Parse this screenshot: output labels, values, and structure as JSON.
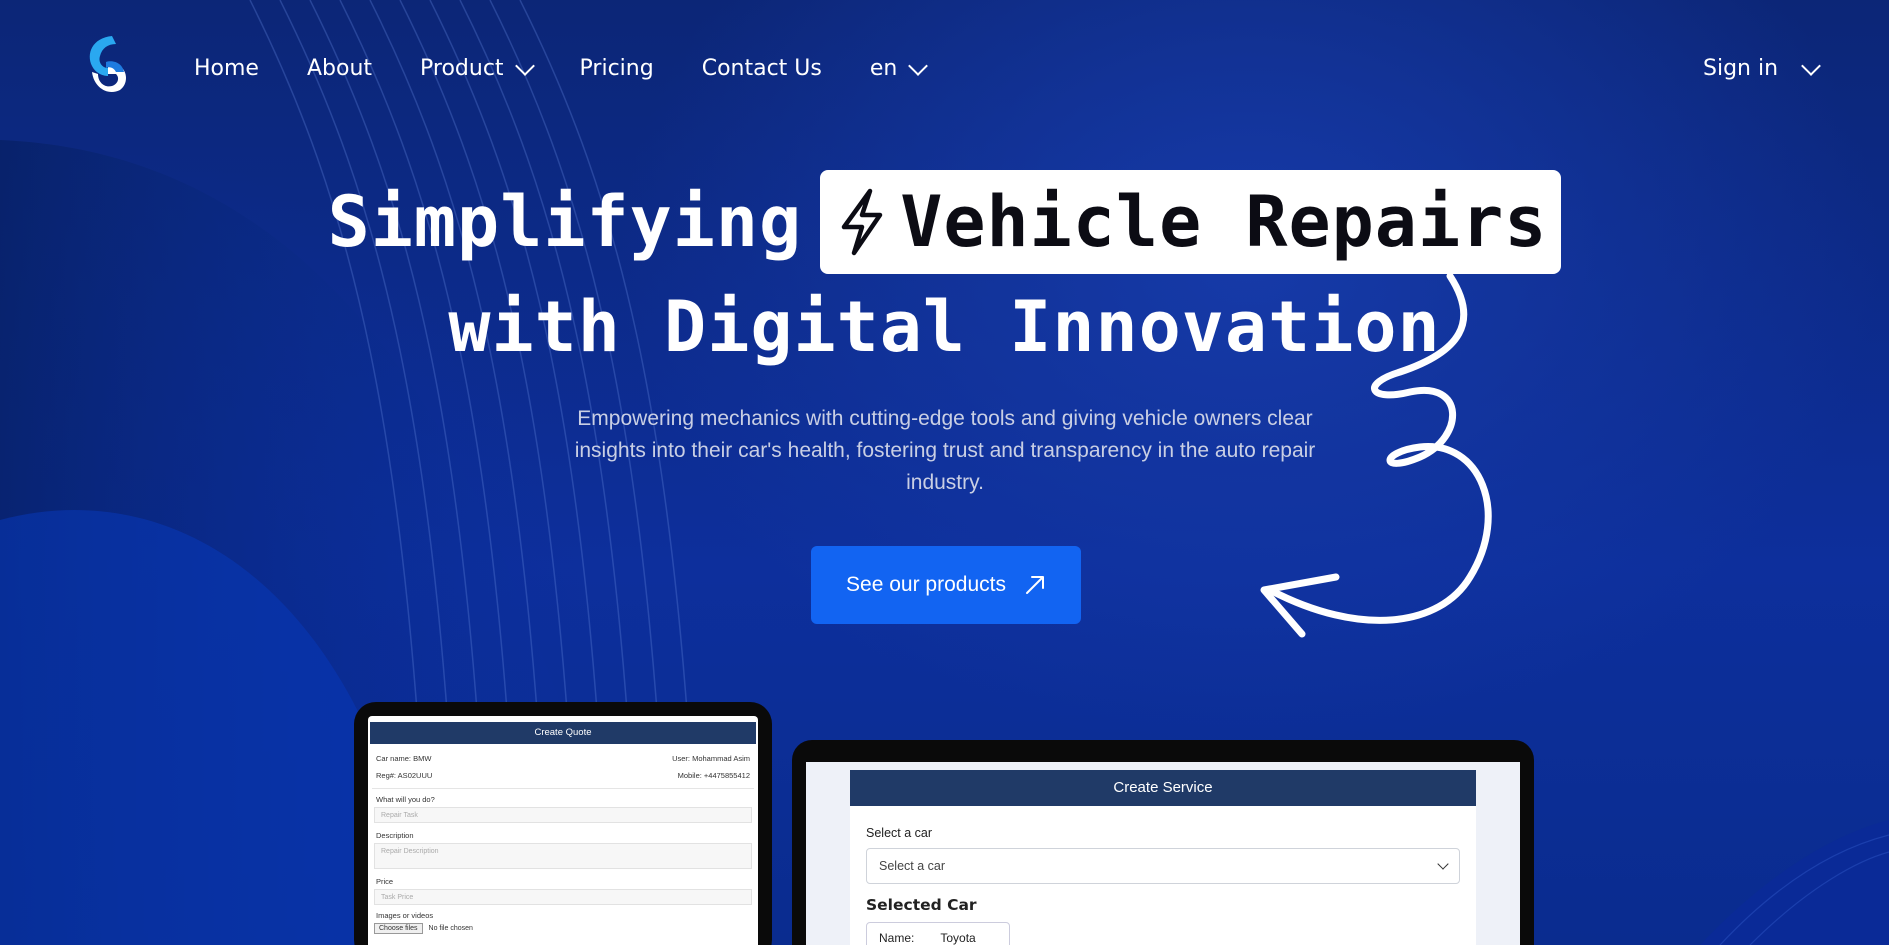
{
  "nav": {
    "items": [
      {
        "label": "Home",
        "dropdown": false
      },
      {
        "label": "About",
        "dropdown": false
      },
      {
        "label": "Product",
        "dropdown": true
      },
      {
        "label": "Pricing",
        "dropdown": false
      },
      {
        "label": "Contact Us",
        "dropdown": false
      },
      {
        "label": "en",
        "dropdown": true
      }
    ],
    "sign_in": "Sign in"
  },
  "hero": {
    "title_part1": "Simplifying",
    "title_highlight": "Vehicle Repairs",
    "title_line2": "with Digital Innovation",
    "subtitle": "Empowering mechanics with cutting-edge tools and giving vehicle owners clear insights into their car's health, fostering trust and transparency in the auto repair industry.",
    "cta_label": "See our products"
  },
  "quote_preview": {
    "header": "Create Quote",
    "car_name": "Car name: BMW",
    "user": "User: Mohammad Asim",
    "reg": "Reg#: AS02UUU",
    "mobile": "Mobile: +4475855412",
    "task_label": "What will you do?",
    "task_placeholder": "Repair Task",
    "desc_label": "Description",
    "desc_placeholder": "Repair Description",
    "price_label": "Price",
    "price_placeholder": "Task Price",
    "media_label": "Images or videos",
    "file_button": "Choose files",
    "file_status": "No file chosen"
  },
  "service_preview": {
    "header": "Create Service",
    "select_label": "Select a car",
    "select_value": "Select a car",
    "selected_heading": "Selected Car",
    "name_label": "Name:",
    "name_value": "Toyota"
  },
  "colors": {
    "background": "#0b2a8e",
    "cta": "#1264f2",
    "panel_header": "#203a67"
  }
}
